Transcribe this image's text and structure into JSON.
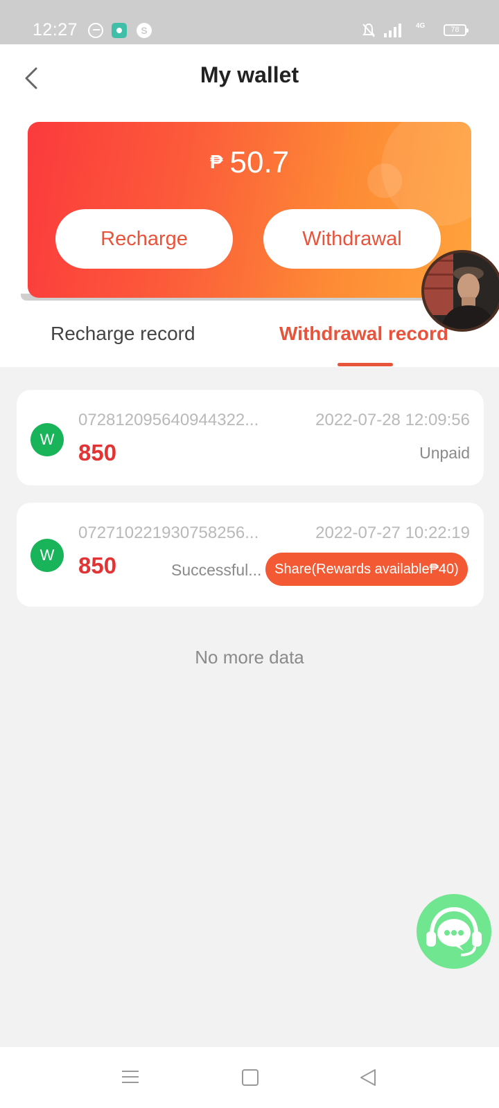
{
  "status_bar": {
    "time": "12:27",
    "network": "4G",
    "battery": "78"
  },
  "header": {
    "title": "My wallet"
  },
  "wallet": {
    "currency_symbol": "₱",
    "balance": "50.7",
    "recharge_label": "Recharge",
    "withdrawal_label": "Withdrawal"
  },
  "tabs": {
    "recharge_record": "Recharge record",
    "withdrawal_record": "Withdrawal record",
    "active": "withdrawal_record"
  },
  "records": [
    {
      "badge": "W",
      "order_no": "072812095640944322...",
      "date": "2022-07-28 12:09:56",
      "amount": "850",
      "status": "Unpaid"
    },
    {
      "badge": "W",
      "order_no": "072710221930758256...",
      "date": "2022-07-27 10:22:19",
      "amount": "850",
      "status": "Successful...",
      "share_label": "Share(Rewards available₱40)"
    }
  ],
  "footer_text": "No more data",
  "colors": {
    "accent": "#e8533c",
    "amount": "#e23434",
    "badge_green": "#19b45a",
    "card_gradient_start": "#fb3a3c",
    "card_gradient_end": "#ffa33c",
    "support_green": "#6fe68f"
  }
}
